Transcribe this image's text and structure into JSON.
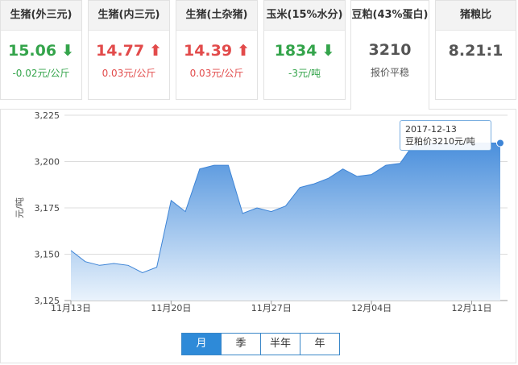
{
  "cards": [
    {
      "title": "生猪(外三元)",
      "value": "15.06",
      "trend": "down",
      "arrow": "⬇",
      "change": "-0.02元/公斤"
    },
    {
      "title": "生猪(内三元)",
      "value": "14.77",
      "trend": "up",
      "arrow": "⬆",
      "change": "0.03元/公斤"
    },
    {
      "title": "生猪(土杂猪)",
      "value": "14.39",
      "trend": "up",
      "arrow": "⬆",
      "change": "0.03元/公斤"
    },
    {
      "title": "玉米(15%水分)",
      "value": "1834",
      "trend": "down",
      "arrow": "⬇",
      "change": "-3元/吨"
    },
    {
      "title": "豆粕(43%蛋白)",
      "value": "3210",
      "trend": "flat",
      "arrow": "",
      "change": "报价平稳"
    },
    {
      "title": "猪粮比",
      "value": "8.21:1",
      "trend": "flat",
      "arrow": "",
      "change": ""
    }
  ],
  "colors": {
    "up": "#e24b4b",
    "down": "#34a44b",
    "area_top": "#4a8fdc",
    "area_bottom": "#eaf3fc",
    "line": "#3d84d6",
    "tab_active": "#2e8ad8"
  },
  "tabs": [
    "月",
    "季",
    "半年",
    "年"
  ],
  "active_tab": 0,
  "tooltip": {
    "date": "2017-12-13",
    "text": "豆粕价3210元/吨"
  },
  "chart_data": {
    "type": "area",
    "ylabel": "元/吨",
    "ylim": [
      3125,
      3225
    ],
    "yticks": [
      3125,
      3150,
      3175,
      3200,
      3225
    ],
    "ytick_labels": [
      "3,125",
      "3,150",
      "3,175",
      "3,200",
      "3,225"
    ],
    "xlim": [
      0,
      30
    ],
    "xticks": [
      0,
      7,
      14,
      21,
      28
    ],
    "xtick_labels": [
      "11月13日",
      "11月20日",
      "11月27日",
      "12月04日",
      "12月11日"
    ],
    "grid": true,
    "series": [
      {
        "x": [
          0,
          1,
          2,
          3,
          4,
          5,
          6,
          7,
          8,
          9,
          10,
          11,
          12,
          13,
          14,
          15,
          16,
          17,
          18,
          19,
          20,
          21,
          22,
          23,
          24,
          25,
          26,
          27,
          28,
          29,
          30
        ],
        "values": [
          3152,
          3146,
          3144,
          3145,
          3144,
          3140,
          3143,
          3179,
          3173,
          3196,
          3198,
          3198,
          3172,
          3175,
          3173,
          3176,
          3186,
          3188,
          3191,
          3196,
          3192,
          3193,
          3198,
          3199,
          3210,
          3210,
          3210,
          3210,
          3210,
          3210,
          3210
        ]
      }
    ]
  }
}
